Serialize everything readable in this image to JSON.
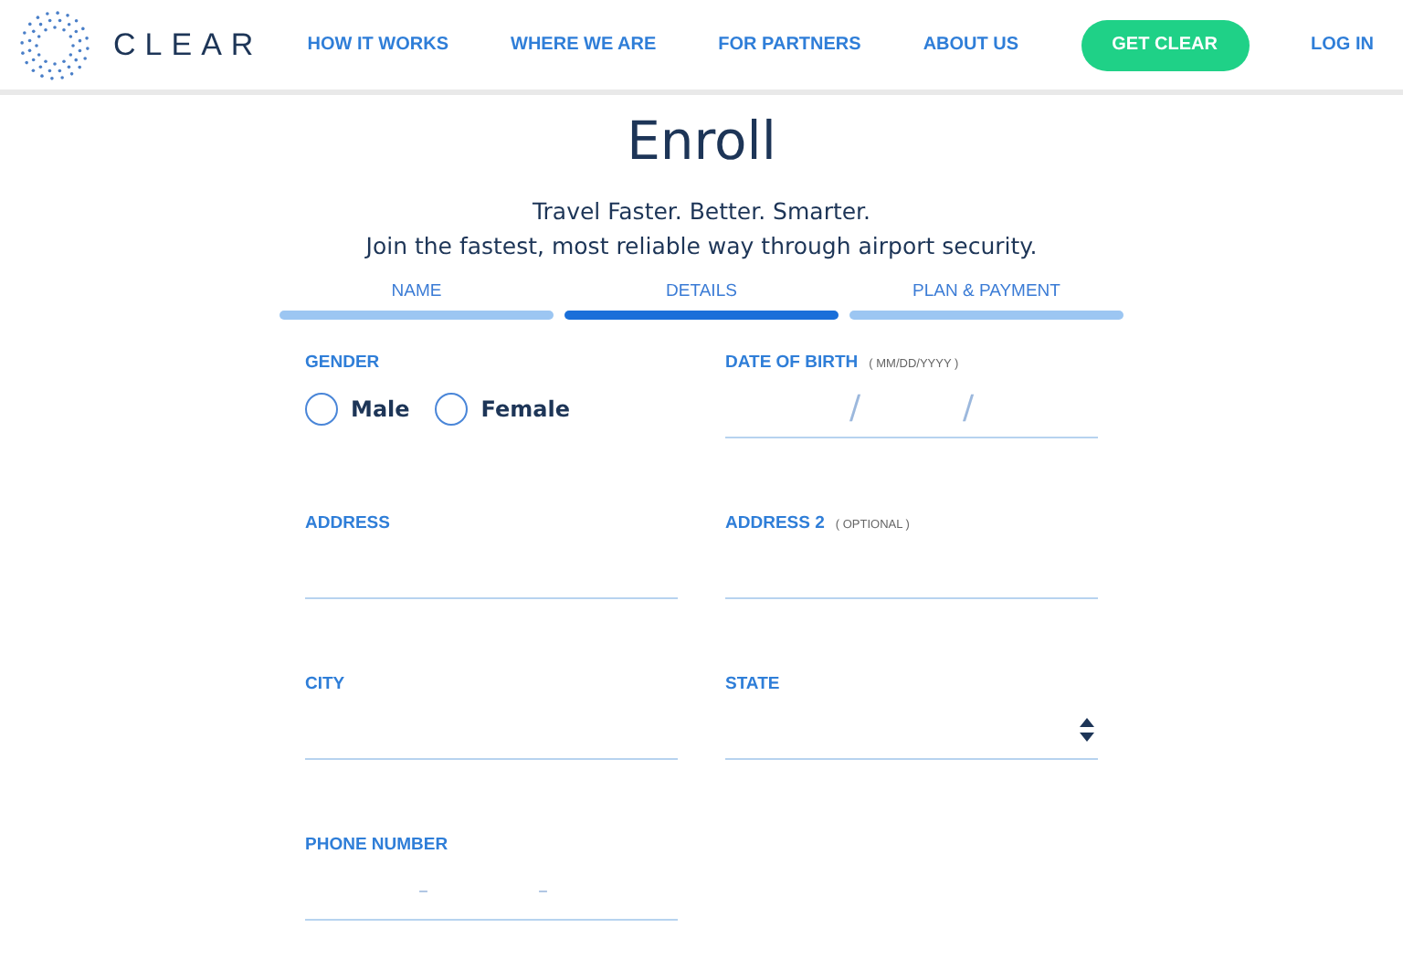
{
  "header": {
    "logo_text": "CLEAR",
    "nav": [
      {
        "label": "HOW IT WORKS",
        "kind": "link"
      },
      {
        "label": "WHERE WE ARE",
        "kind": "link"
      },
      {
        "label": "FOR PARTNERS",
        "kind": "link"
      },
      {
        "label": "ABOUT US",
        "kind": "link"
      },
      {
        "label": "GET CLEAR",
        "kind": "button"
      },
      {
        "label": "LOG IN",
        "kind": "link"
      }
    ]
  },
  "title": "Enroll",
  "subtitle": [
    "Travel Faster. Better. Smarter.",
    "Join the fastest, most reliable way through airport security."
  ],
  "steps": [
    {
      "label": "NAME",
      "selected": false
    },
    {
      "label": "DETAILS",
      "selected": true
    },
    {
      "label": "PLAN & PAYMENT",
      "selected": false
    }
  ],
  "fields": [
    {
      "kind": "radio",
      "label": "GENDER",
      "options": [
        {
          "label": "Male",
          "selected": false
        },
        {
          "label": "Female",
          "selected": false
        }
      ]
    },
    {
      "kind": "segmented",
      "label": "DATE OF BIRTH",
      "hint": "( MM/DD/YYYY )",
      "separators": [
        "/",
        "/"
      ]
    },
    {
      "kind": "text",
      "label": "ADDRESS"
    },
    {
      "kind": "text",
      "label": "ADDRESS 2",
      "hint": "( OPTIONAL )"
    },
    {
      "kind": "text",
      "label": "CITY"
    },
    {
      "kind": "select",
      "label": "STATE"
    },
    {
      "kind": "phone",
      "label": "PHONE NUMBER",
      "separators": [
        "–",
        "–"
      ]
    }
  ]
}
